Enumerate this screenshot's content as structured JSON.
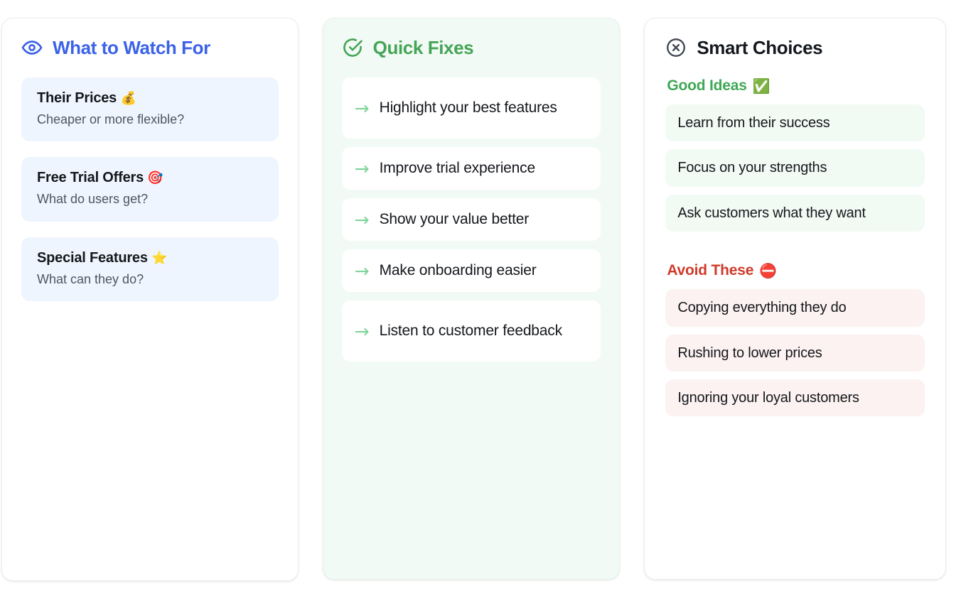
{
  "cards": [
    {
      "id": "what-to-watch-for",
      "title": "What to Watch For",
      "icon": "eye-icon",
      "accent": "#3b62e8",
      "background": "#ffffff",
      "item_background": "#eff5fe",
      "items": [
        {
          "title": "Their Prices",
          "emoji": "💰",
          "subtitle": "Cheaper or more flexible?"
        },
        {
          "title": "Free Trial Offers",
          "emoji": "🎯",
          "subtitle": "What do users get?"
        },
        {
          "title": "Special Features",
          "emoji": "⭐",
          "subtitle": "What can they do?"
        }
      ]
    },
    {
      "id": "quick-fixes",
      "title": "Quick Fixes",
      "icon": "check-circle-icon",
      "accent": "#45a556",
      "background": "#f2faf5",
      "item_background": "#ffffff",
      "arrow_glyph": "→",
      "arrow_color": "#7ed39a",
      "items": [
        {
          "text": "Highlight your best features"
        },
        {
          "text": "Improve trial experience"
        },
        {
          "text": "Show your value better"
        },
        {
          "text": "Make onboarding easier"
        },
        {
          "text": "Listen to customer feedback"
        }
      ]
    },
    {
      "id": "smart-choices",
      "title": "Smart Choices",
      "icon": "x-circle-icon",
      "accent": "#15191f",
      "background": "#ffffff",
      "sections": [
        {
          "id": "good-ideas",
          "label": "Good Ideas",
          "emoji": "✅",
          "color": "#3fa855",
          "item_background": "#f2faf4",
          "items": [
            "Learn from their success",
            "Focus on your strengths",
            "Ask customers what they want"
          ]
        },
        {
          "id": "avoid-these",
          "label": "Avoid These",
          "emoji": "⛔",
          "color": "#cf3b2b",
          "item_background": "#fcf2f1",
          "items": [
            "Copying everything they do",
            "Rushing to lower prices",
            "Ignoring your loyal customers"
          ]
        }
      ]
    }
  ]
}
